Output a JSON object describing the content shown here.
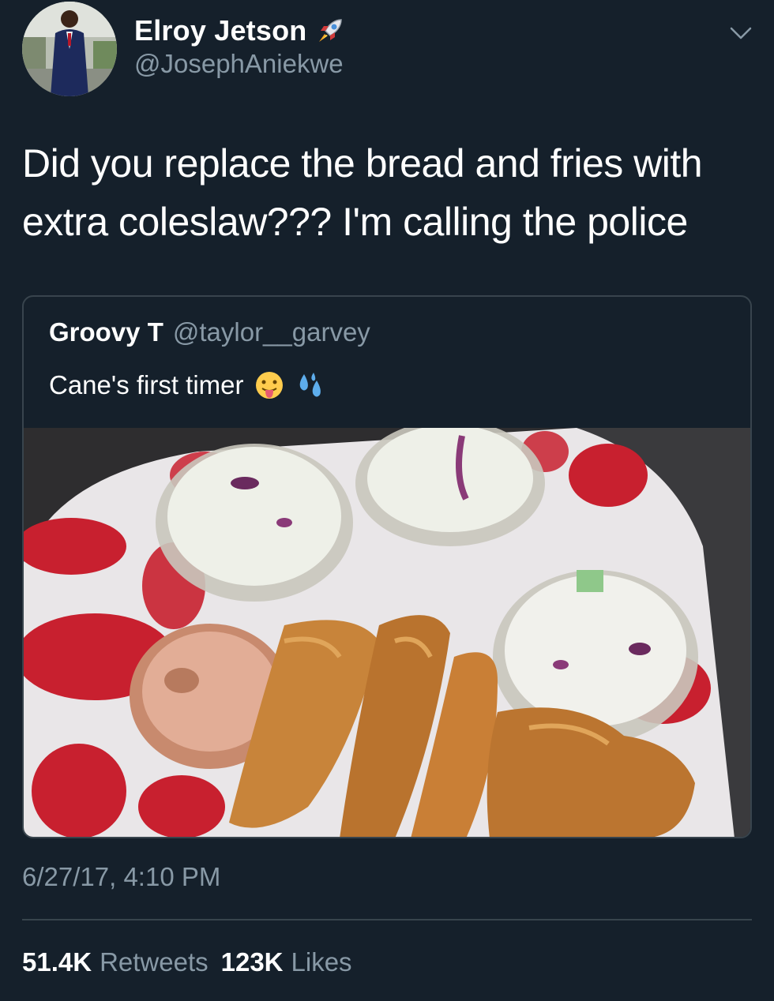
{
  "author": {
    "display_name": "Elroy Jetson",
    "handle": "@JosephAniekwe",
    "badge_icon": "rocket-emoji"
  },
  "tweet": {
    "text": "Did you replace the bread and fries with extra coleslaw??? I'm calling the police",
    "timestamp": "6/27/17, 4:10 PM"
  },
  "quoted": {
    "display_name": "Groovy T",
    "handle": "@taylor__garvey",
    "text": "Cane's first timer",
    "emojis": [
      "tongue-out-emoji",
      "sweat-droplets-emoji"
    ]
  },
  "stats": {
    "retweets_count": "51.4K",
    "retweets_label": "Retweets",
    "likes_count": "123K",
    "likes_label": "Likes"
  },
  "colors": {
    "background": "#15202b",
    "secondary_text": "#8899a6",
    "border": "#38444d",
    "brand_red": "#c8202f"
  }
}
